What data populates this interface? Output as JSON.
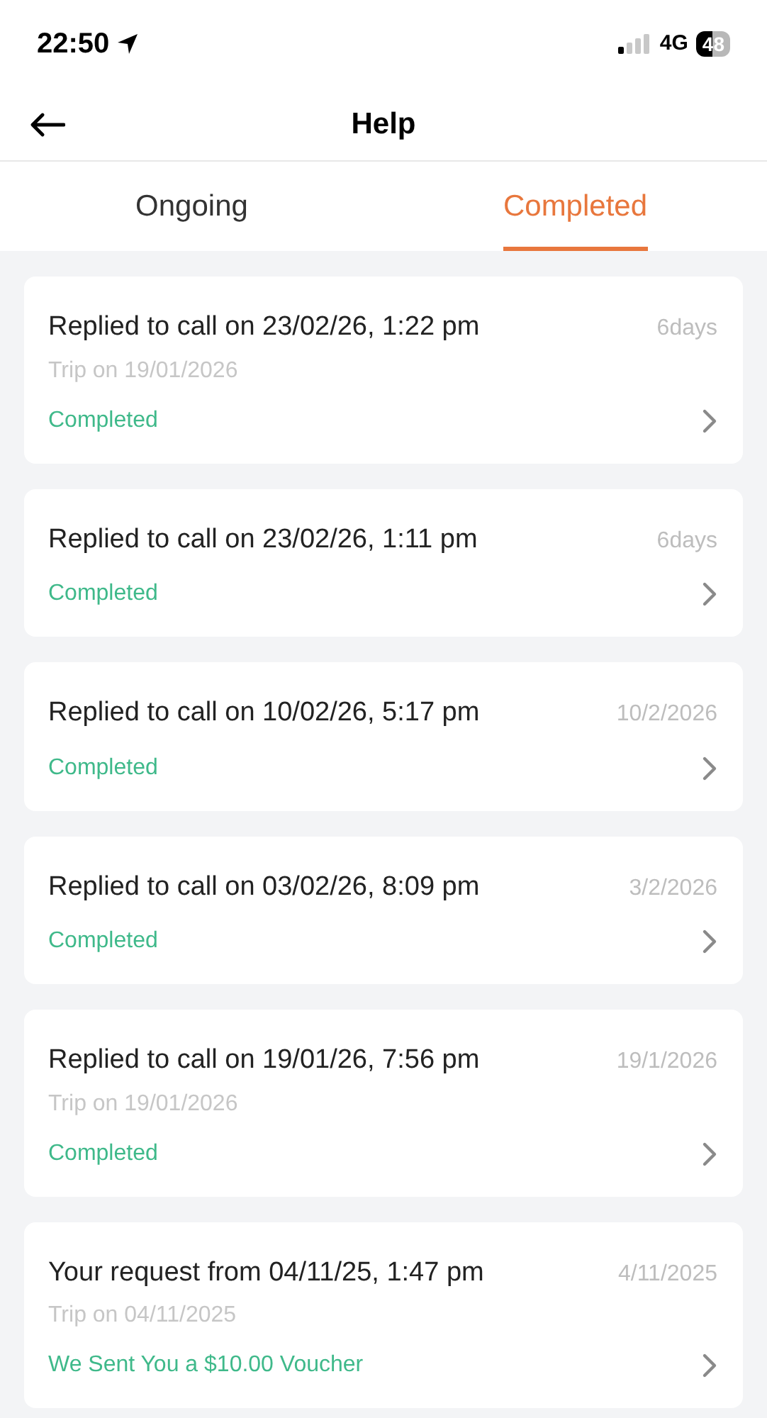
{
  "status_bar": {
    "time": "22:50",
    "network": "4G",
    "battery": "48"
  },
  "header": {
    "title": "Help"
  },
  "tabs": [
    {
      "label": "Ongoing",
      "selected": false
    },
    {
      "label": "Completed",
      "selected": true
    }
  ],
  "tickets": [
    {
      "title": "Replied to call on 23/02/26, 1:22 pm",
      "trip": "Trip on 19/01/2026",
      "status": "Completed",
      "age": "6days"
    },
    {
      "title": "Replied to call on 23/02/26, 1:11 pm",
      "status": "Completed",
      "age": "6days"
    },
    {
      "title": "Replied to call on 10/02/26, 5:17 pm",
      "status": "Completed",
      "age": "10/2/2026"
    },
    {
      "title": "Replied to call on 03/02/26, 8:09 pm",
      "status": "Completed",
      "age": "3/2/2026"
    },
    {
      "title": "Replied to call on 19/01/26, 7:56 pm",
      "trip": "Trip on 19/01/2026",
      "status": "Completed",
      "age": "19/1/2026"
    },
    {
      "title": "Your request from 04/11/25, 1:47 pm",
      "trip": "Trip on 04/11/2025",
      "status": "We Sent You a $10.00 Voucher",
      "age": "4/11/2025"
    }
  ]
}
